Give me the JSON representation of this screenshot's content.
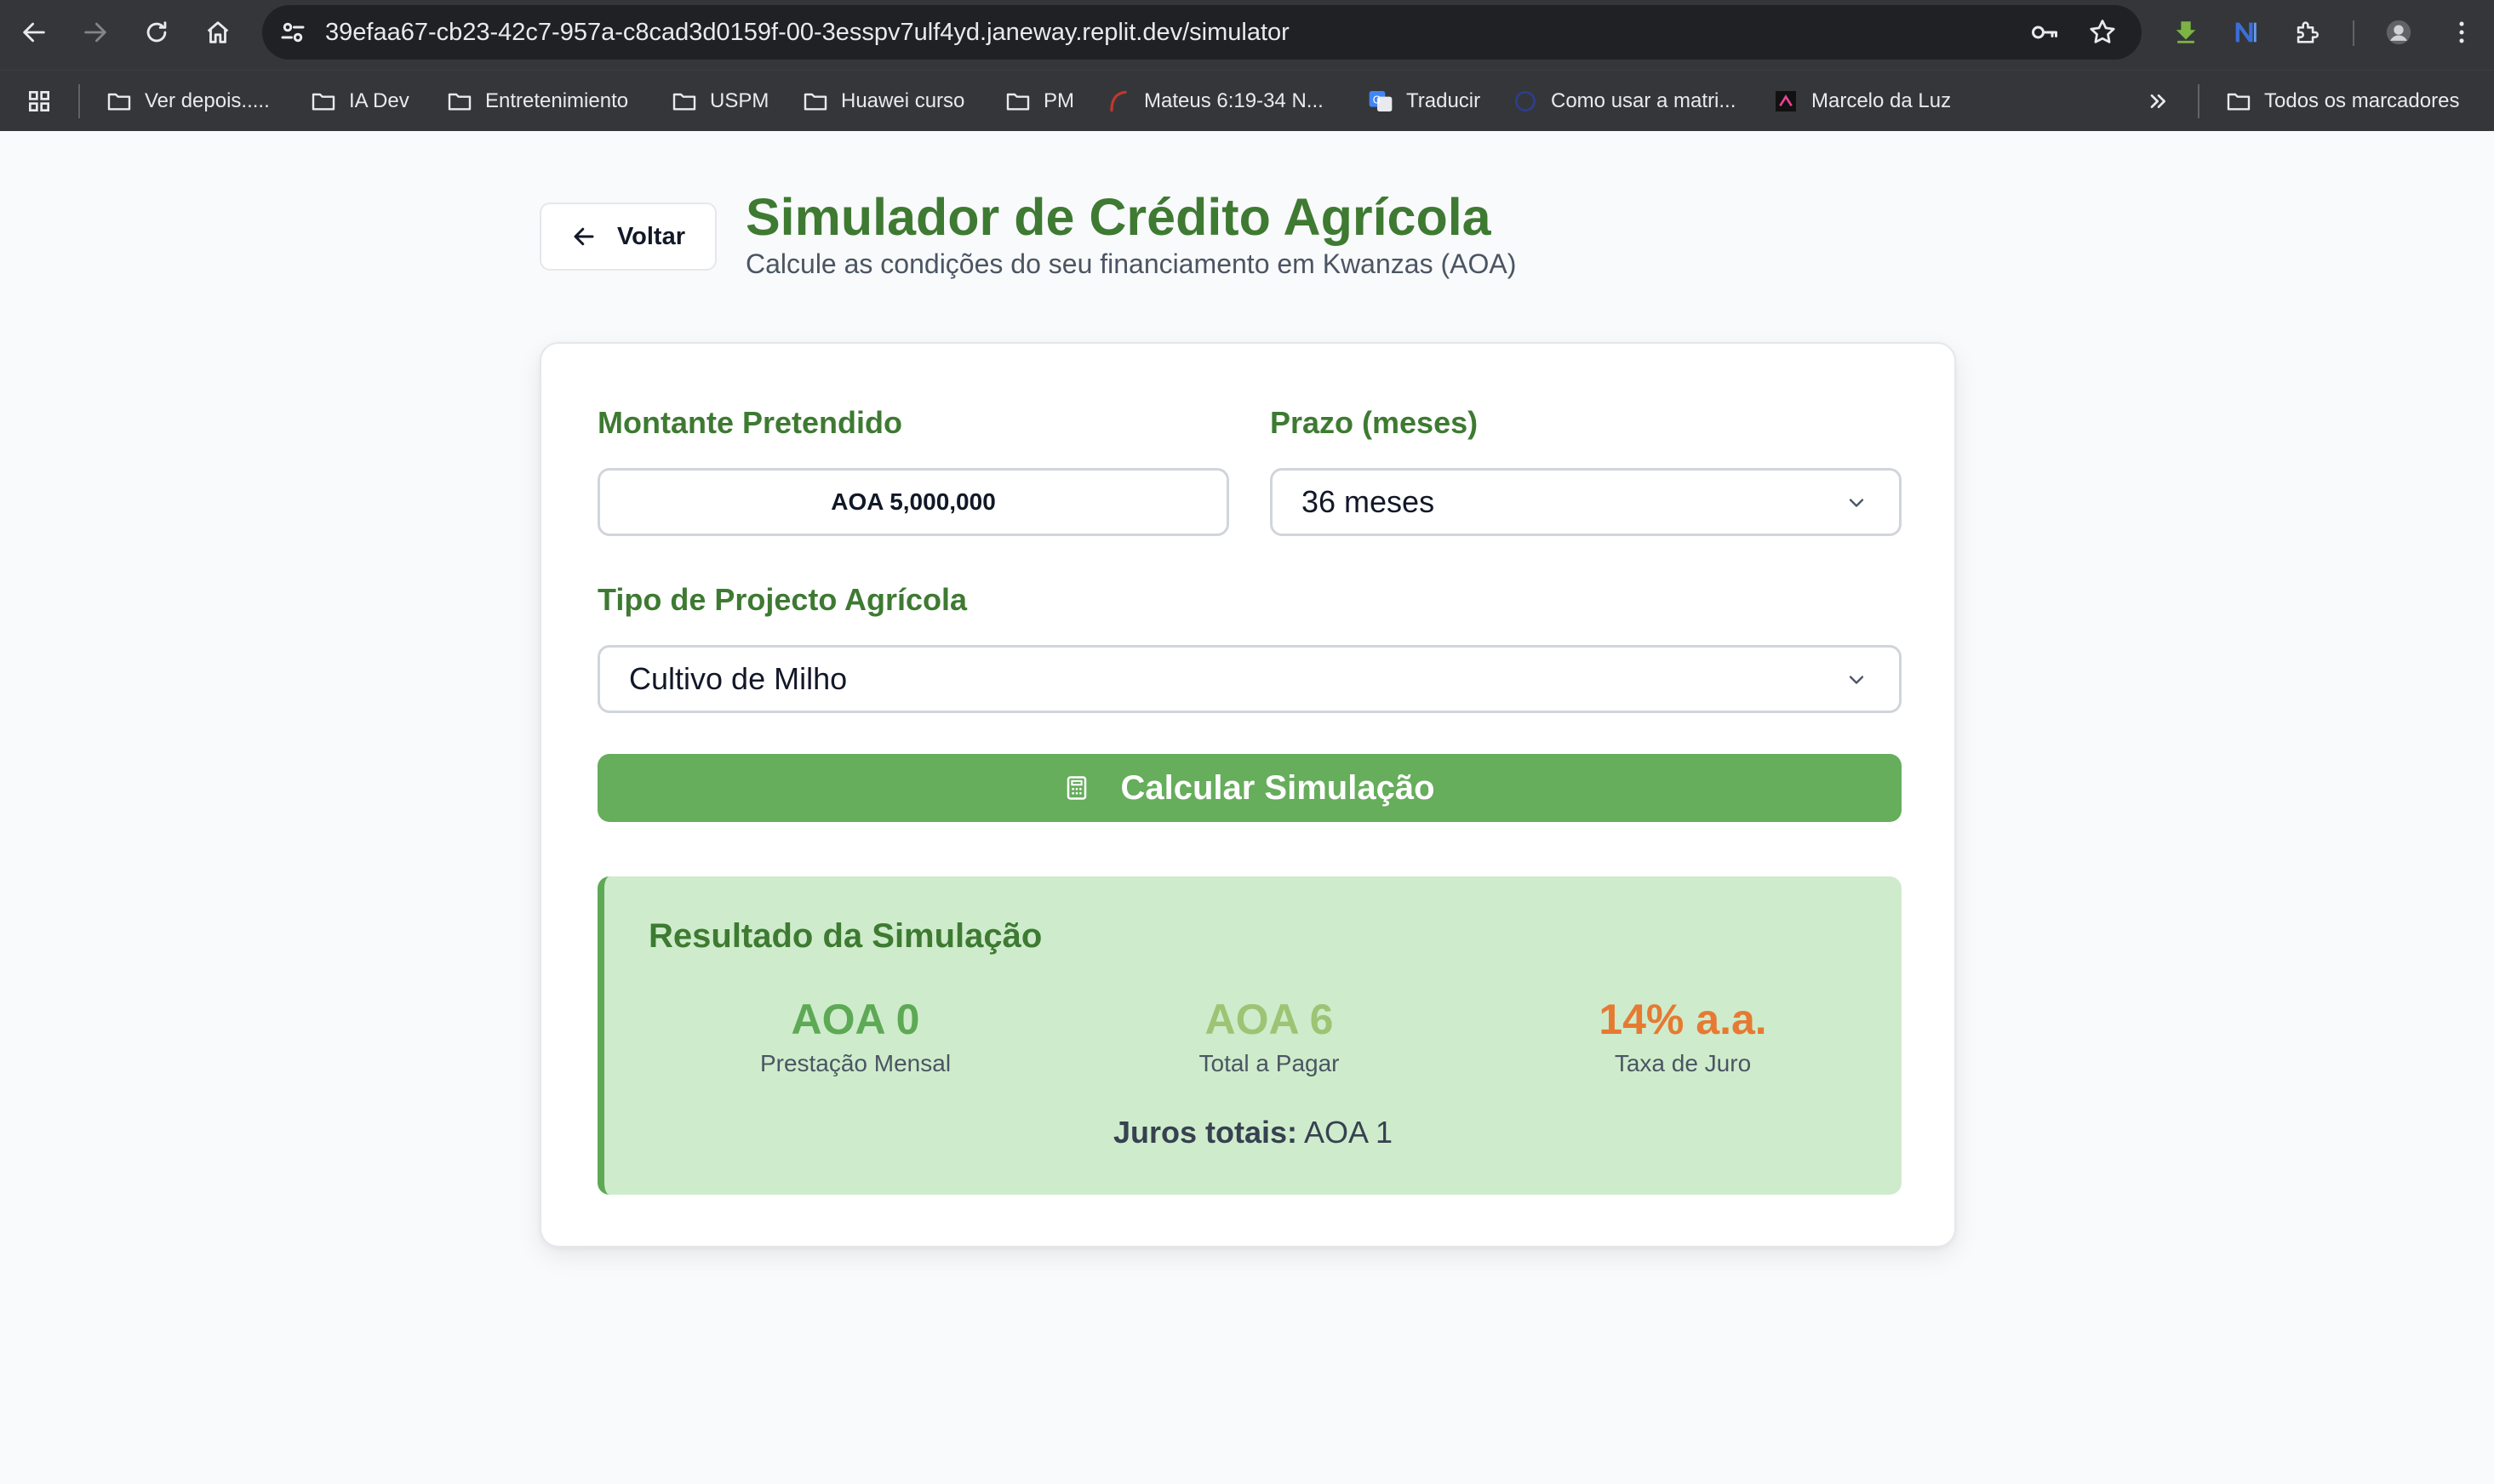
{
  "browser": {
    "url_host": "39efaa67-cb23-42c7-957a-c8cad3d0159f-00-3esspv7ulf4yd.janeway.replit.dev",
    "url_path": "/simulator",
    "bookmarks": [
      {
        "label": "Ver depois.....",
        "icon": "folder-icon"
      },
      {
        "label": "IA Dev",
        "icon": "folder-icon"
      },
      {
        "label": "Entretenimiento",
        "icon": "folder-icon"
      },
      {
        "label": "USPM",
        "icon": "folder-icon"
      },
      {
        "label": "Huawei curso",
        "icon": "folder-icon"
      },
      {
        "label": "PM",
        "icon": "folder-icon"
      },
      {
        "label": "Mateus 6:19-34 N...",
        "icon": "site-icon"
      },
      {
        "label": "Traducir",
        "icon": "translate-icon"
      },
      {
        "label": "Como usar a matri...",
        "icon": "site-icon"
      },
      {
        "label": "Marcelo da Luz",
        "icon": "site-icon"
      }
    ],
    "all_bookmarks_label": "Todos os marcadores"
  },
  "header": {
    "back_label": "Voltar",
    "title": "Simulador de Crédito Agrícola",
    "subtitle": "Calcule as condições do seu financiamento em Kwanzas (AOA)"
  },
  "form": {
    "amount_label": "Montante Pretendido",
    "amount_value": "AOA 5,000,000",
    "term_label": "Prazo (meses)",
    "term_value": "36 meses",
    "project_label": "Tipo de Projecto Agrícola",
    "project_value": "Cultivo de Milho",
    "calculate_label": "Calcular Simulação"
  },
  "result": {
    "title": "Resultado da Simulação",
    "monthly_value": "AOA 0",
    "monthly_label": "Prestação Mensal",
    "total_value": "AOA 6",
    "total_label": "Total a Pagar",
    "rate_value": "14% a.a.",
    "rate_label": "Taxa de Juro",
    "interest_label": "Juros totais:",
    "interest_value": "AOA 1"
  },
  "colors": {
    "brand_green": "#3e7a32",
    "button_green": "#66ad5c",
    "result_bg": "#ceeccb",
    "monthly_color": "#5ea955",
    "total_color": "#9dc474",
    "rate_color": "#e67a33"
  }
}
